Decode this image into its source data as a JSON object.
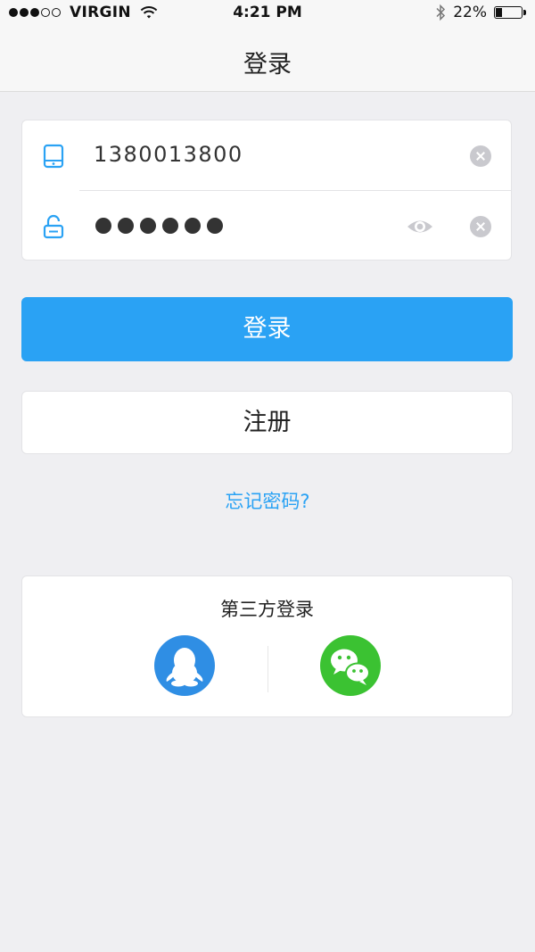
{
  "status_bar": {
    "carrier": "VIRGIN",
    "time": "4:21 PM",
    "battery": "22%",
    "battery_level": 0.22,
    "signal_bars_filled": 3,
    "signal_bars_total": 5
  },
  "nav": {
    "title": "登录"
  },
  "form": {
    "phone": {
      "value": "1380013800",
      "icon": "phone-icon"
    },
    "password": {
      "masked_length": 6,
      "icon": "unlock-icon"
    },
    "icons": {
      "clear": "clear-icon",
      "visibility": "eye-icon"
    }
  },
  "buttons": {
    "login": "登录",
    "register": "注册",
    "forgot_password": "忘记密码?"
  },
  "third_party": {
    "title": "第三方登录",
    "providers": [
      {
        "name": "qq",
        "icon": "qq-icon"
      },
      {
        "name": "wechat",
        "icon": "wechat-icon"
      }
    ]
  },
  "colors": {
    "accent": "#2aa2f4",
    "background": "#efeff2",
    "qq": "#2f8ee4",
    "wechat": "#3bc232"
  }
}
